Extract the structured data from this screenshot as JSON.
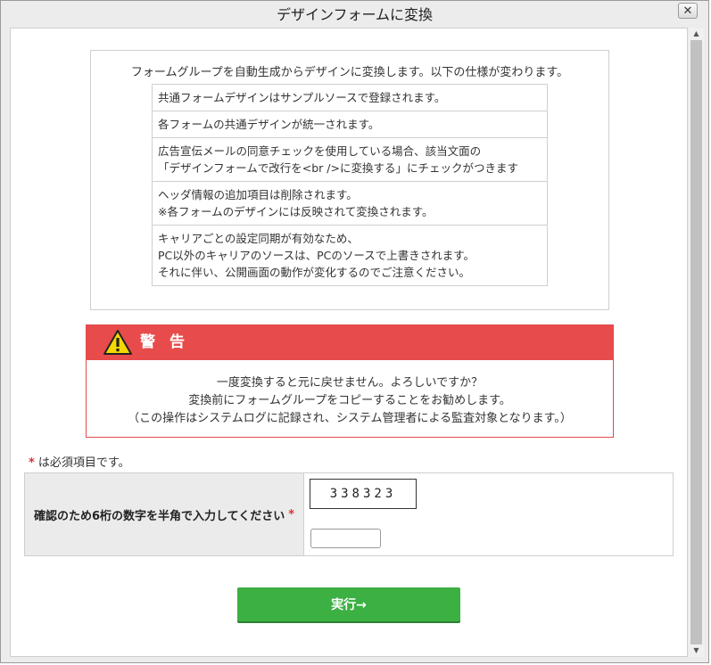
{
  "dialog": {
    "title": "デザインフォームに変換",
    "close_label": "✕"
  },
  "spec": {
    "intro": "フォームグループを自動生成からデザインに変換します。以下の仕様が変わります。",
    "items": [
      "共通フォームデザインはサンプルソースで登録されます。",
      "各フォームの共通デザインが統一されます。",
      "広告宣伝メールの同意チェックを使用している場合、該当文面の\n「デザインフォームで改行を<br />に変換する」にチェックがつきます",
      "ヘッダ情報の追加項目は削除されます。\n※各フォームのデザインには反映されて変換されます。",
      "キャリアごとの設定同期が有効なため、\nPC以外のキャリアのソースは、PCのソースで上書きされます。\nそれに伴い、公開画面の動作が変化するのでご注意ください。"
    ]
  },
  "warning": {
    "title": "警告",
    "icon": "warning-triangle-icon",
    "lines": [
      "一度変換すると元に戻せません。よろしいですか？",
      "変換前にフォームグループをコピーすることをお勧めします。",
      "（この操作はシステムログに記録され、システム管理者による監査対象となります。）"
    ],
    "color": "#e84b4b"
  },
  "required_note": {
    "star": "*",
    "text": "は必須項目です。"
  },
  "form": {
    "label": "確認のため6桁の数字を半角で入力してください",
    "required_star": "*",
    "captcha": "338323",
    "input_value": ""
  },
  "submit": {
    "label": "実行→",
    "color": "#3cb043"
  }
}
